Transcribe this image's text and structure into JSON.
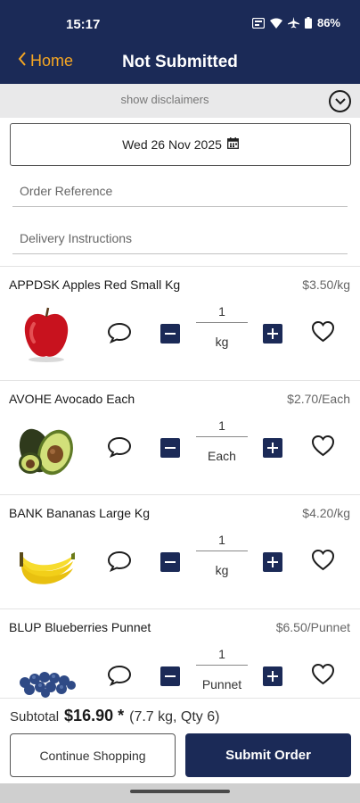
{
  "status_bar": {
    "time": "15:17",
    "battery": "86%",
    "icons": [
      "sim-card-icon",
      "wifi-icon",
      "airplane-icon",
      "battery-icon"
    ]
  },
  "header": {
    "back_label": "Home",
    "title": "Not Submitted"
  },
  "disclaimer": {
    "label": "show disclaimers"
  },
  "delivery_date": "Wed 26 Nov 2025",
  "fields": {
    "order_reference_placeholder": "Order Reference",
    "delivery_instructions_placeholder": "Delivery Instructions"
  },
  "products": [
    {
      "name": "APPDSK Apples Red Small Kg",
      "price": "$3.50/kg",
      "quantity": "1",
      "unit": "kg",
      "image": "red-apple"
    },
    {
      "name": "AVOHE Avocado  Each",
      "price": "$2.70/Each",
      "quantity": "1",
      "unit": "Each",
      "image": "avocado"
    },
    {
      "name": "BANK Bananas Large Kg",
      "price": "$4.20/kg",
      "quantity": "1",
      "unit": "kg",
      "image": "bananas"
    },
    {
      "name": "BLUP Blueberries Punnet",
      "price": "$6.50/Punnet",
      "quantity": "1",
      "unit": "Punnet",
      "image": "blueberries"
    }
  ],
  "summary": {
    "subtotal_label": "Subtotal",
    "subtotal_amount": "$16.90 *",
    "subtotal_detail": "(7.7 kg, Qty 6)"
  },
  "buttons": {
    "continue_shopping": "Continue Shopping",
    "submit_order": "Submit Order"
  },
  "colors": {
    "brand_navy": "#1b2a57",
    "back_orange": "#f5a623",
    "disclaimer_bg": "#e9e9ea"
  }
}
